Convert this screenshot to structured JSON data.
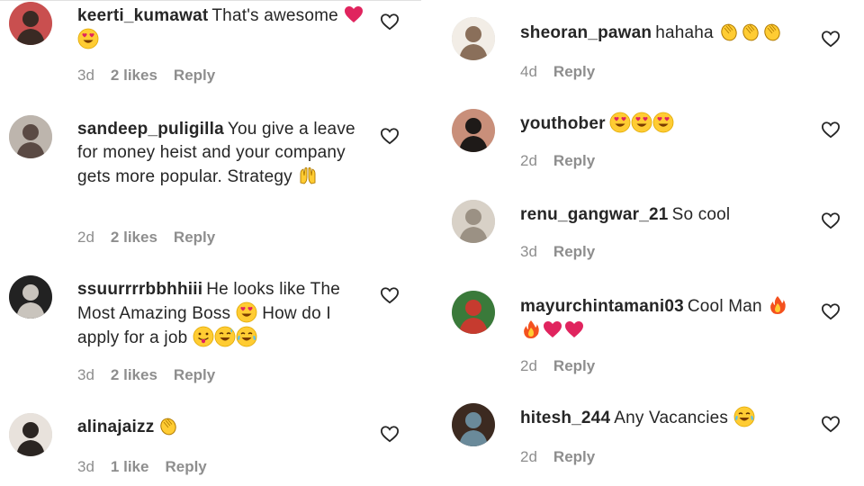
{
  "left_comments": [
    {
      "username": "keerti_kumawat",
      "text": "That's awesome",
      "emojis": [
        "red-heart",
        "heart-eyes"
      ],
      "time": "3d",
      "likes": "2 likes",
      "reply": "Reply"
    },
    {
      "username": "sandeep_puligilla",
      "text": "You give a leave for money heist and your company gets more popular. Strategy",
      "emojis": [
        "raising-hands"
      ],
      "time": "2d",
      "likes": "2 likes",
      "reply": "Reply"
    },
    {
      "username": "ssuurrrrbbhhiii",
      "text": "He looks like The Most Amazing Boss",
      "text2": "How do I apply for a job",
      "emojis": [
        "heart-eyes"
      ],
      "emojis2": [
        "tongue-out",
        "sweat-smile",
        "tears-of-joy"
      ],
      "time": "3d",
      "likes": "2 likes",
      "reply": "Reply"
    },
    {
      "username": "alinajaizz",
      "text": "",
      "emojis": [
        "clapping-hands"
      ],
      "time": "3d",
      "likes": "1 like",
      "reply": "Reply"
    }
  ],
  "right_comments": [
    {
      "username": "sheoran_pawan",
      "text": "hahaha",
      "emojis": [
        "clapping-hands",
        "clapping-hands",
        "clapping-hands"
      ],
      "time": "4d",
      "reply": "Reply"
    },
    {
      "username": "youthober",
      "text": "",
      "emojis": [
        "heart-eyes",
        "heart-eyes",
        "heart-eyes"
      ],
      "time": "2d",
      "reply": "Reply"
    },
    {
      "username": "renu_gangwar_21",
      "text": "So cool",
      "emojis": [],
      "time": "3d",
      "reply": "Reply"
    },
    {
      "username": "mayurchintamani03",
      "text": "Cool Man",
      "emojis": [
        "fire",
        "fire",
        "red-heart",
        "red-heart"
      ],
      "time": "2d",
      "reply": "Reply"
    },
    {
      "username": "hitesh_244",
      "text": "Any Vacancies",
      "emojis": [
        "tears-of-joy"
      ],
      "time": "2d",
      "reply": "Reply"
    }
  ],
  "icons": {
    "like": "heart-outline-icon"
  },
  "colors": {
    "text": "#262626",
    "meta": "#8e8e8e",
    "heart": "#e0245e",
    "emoji_yellow": "#ffcc33"
  }
}
